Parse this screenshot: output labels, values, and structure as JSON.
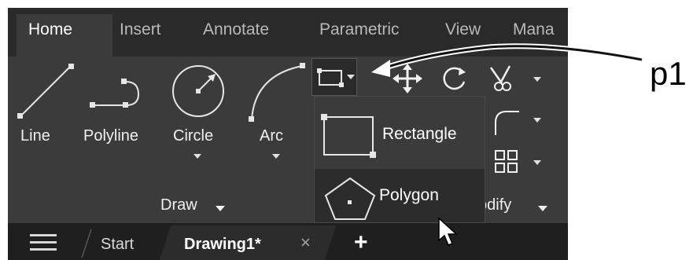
{
  "ribbon": {
    "tabs": [
      "Home",
      "Insert",
      "Annotate",
      "Parametric",
      "View",
      "Mana"
    ]
  },
  "draw_panel": {
    "tools": [
      {
        "label": "Line"
      },
      {
        "label": "Polyline"
      },
      {
        "label": "Circle"
      },
      {
        "label": "Arc"
      }
    ],
    "title": "Draw"
  },
  "modify_panel": {
    "title": "odify"
  },
  "flyout": {
    "items": [
      {
        "label": "Rectangle"
      },
      {
        "label": "Polygon"
      }
    ]
  },
  "document_tabs": {
    "start": "Start",
    "drawing": "Drawing1*",
    "close": "×",
    "new": "+"
  },
  "annotation": {
    "label": "p1"
  },
  "colors": {
    "ribbon_bg": "#3b3b3b",
    "tab_bar_bg": "#2a2a2a",
    "doc_bar_bg": "#1f1f1f",
    "text": "#f0f0f0"
  }
}
